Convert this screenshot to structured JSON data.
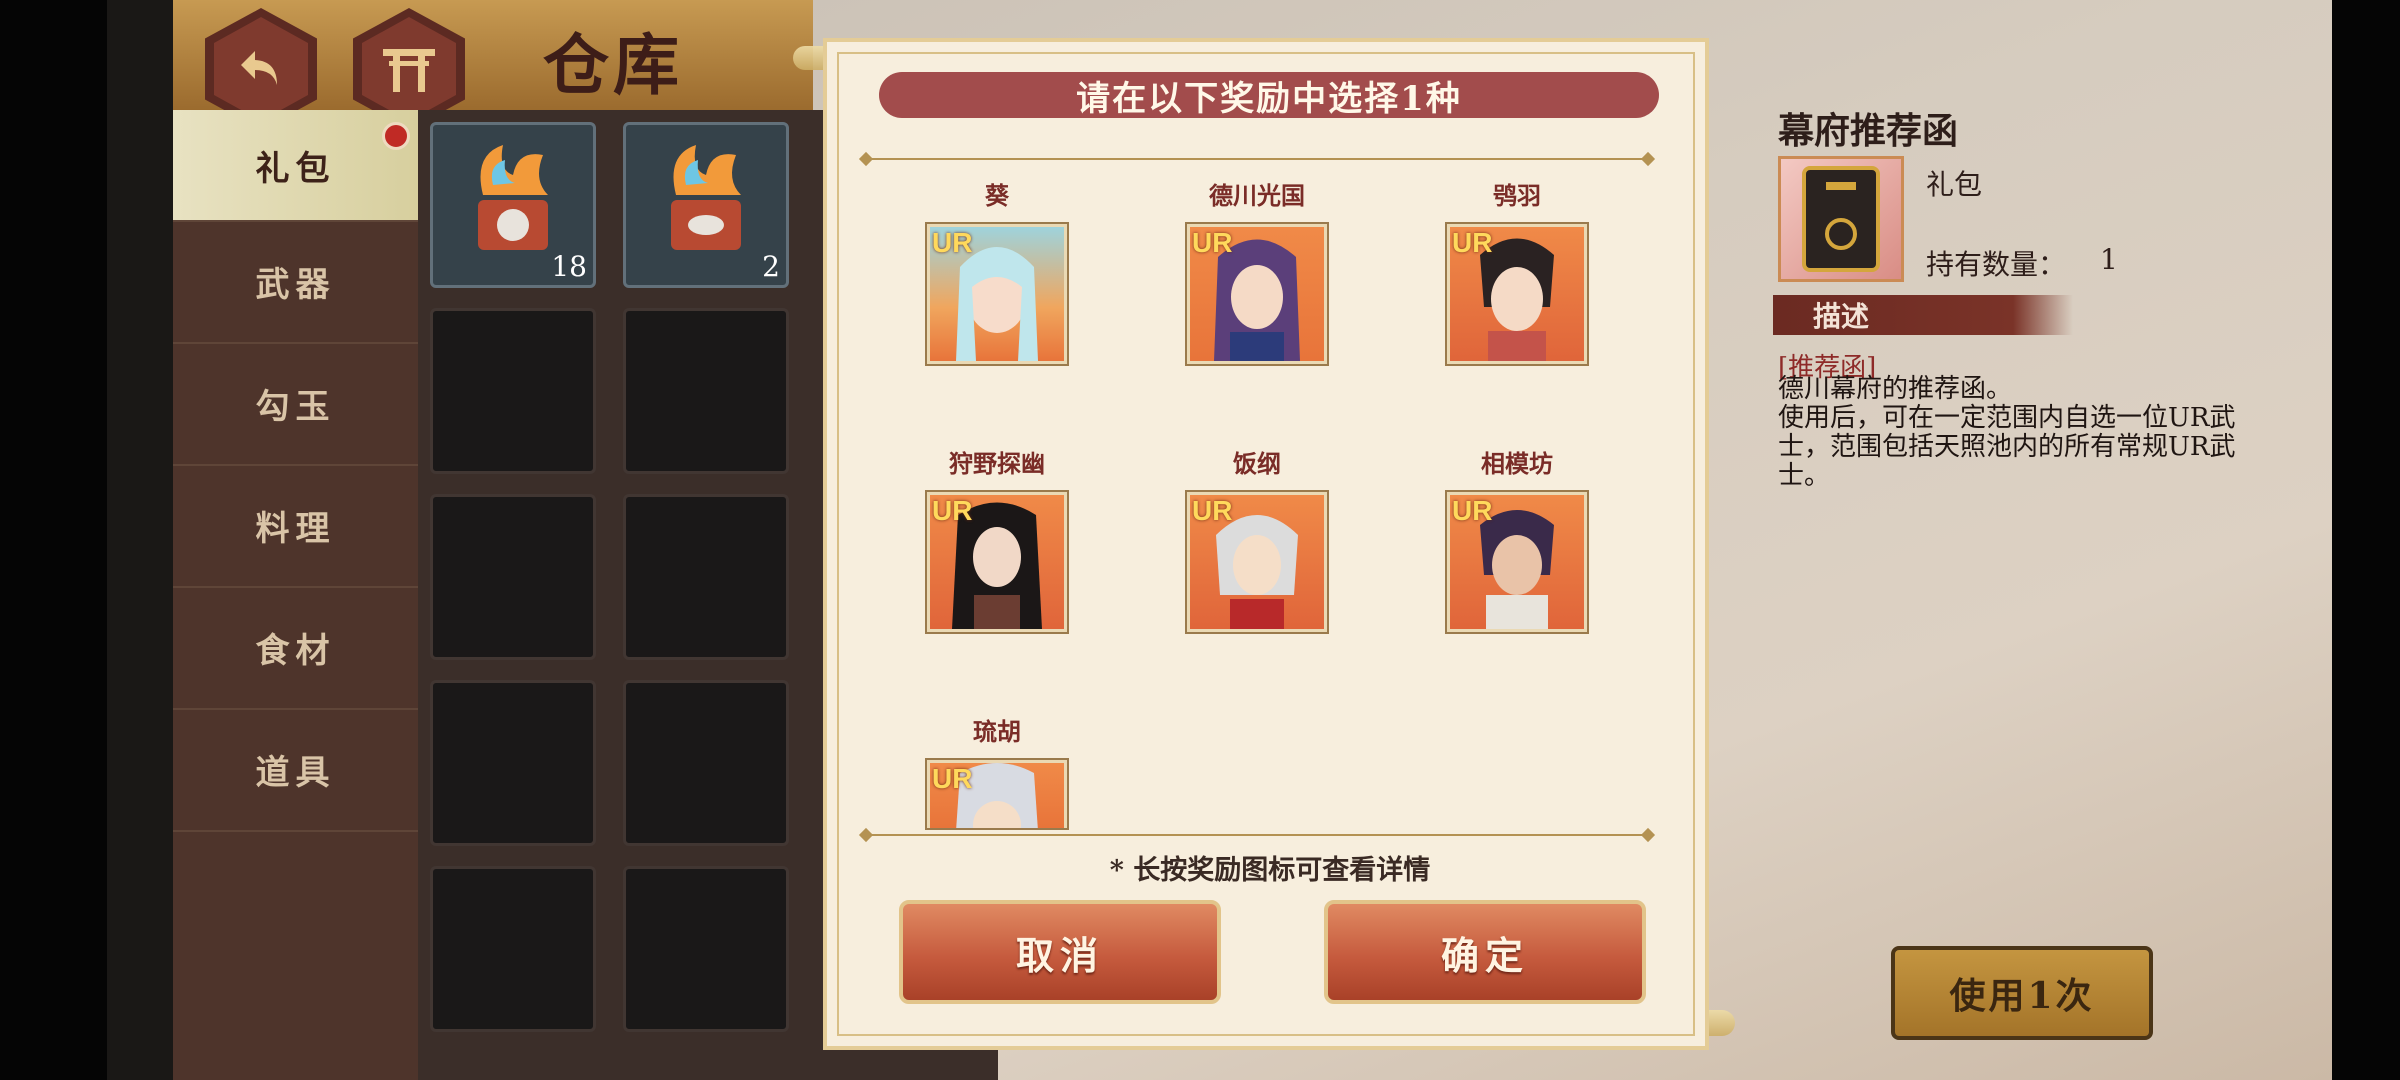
{
  "header": {
    "title": "仓库"
  },
  "sidebar": {
    "items": [
      {
        "label": "礼包",
        "active": true
      },
      {
        "label": "武器"
      },
      {
        "label": "勾玉"
      },
      {
        "label": "料理"
      },
      {
        "label": "食材"
      },
      {
        "label": "道具"
      }
    ]
  },
  "grid": {
    "items": [
      {
        "count": "18"
      },
      {
        "count": "2"
      }
    ]
  },
  "dialog": {
    "title": "请在以下奖励中选择1种",
    "rarity_badge": "UR",
    "rewards": [
      {
        "name": "葵"
      },
      {
        "name": "德川光国"
      },
      {
        "name": "鸮羽"
      },
      {
        "name": "狩野探幽"
      },
      {
        "name": "饭纲"
      },
      {
        "name": "相模坊"
      },
      {
        "name": "琉胡"
      }
    ],
    "hint": "* 长按奖励图标可查看详情",
    "cancel_label": "取消",
    "confirm_label": "确定"
  },
  "detail": {
    "title": "幕府推荐函",
    "type": "礼包",
    "count_label": "持有数量：",
    "count": "1",
    "desc_header": "描述",
    "desc_tag": "[推荐函]",
    "desc_line1": "德川幕府的推荐函。",
    "desc_line2": "使用后，可在一定范围内自选一位UR武士，范围包括天照池内的所有常规UR武士。",
    "use_button": "使用1次"
  },
  "colors": {
    "accent_red": "#a24c4c",
    "dialog_bg": "#f7eedd",
    "sidebar_bg": "#4e342b",
    "button_orange": "#c65b3e",
    "use_button_gold": "#c49540"
  }
}
